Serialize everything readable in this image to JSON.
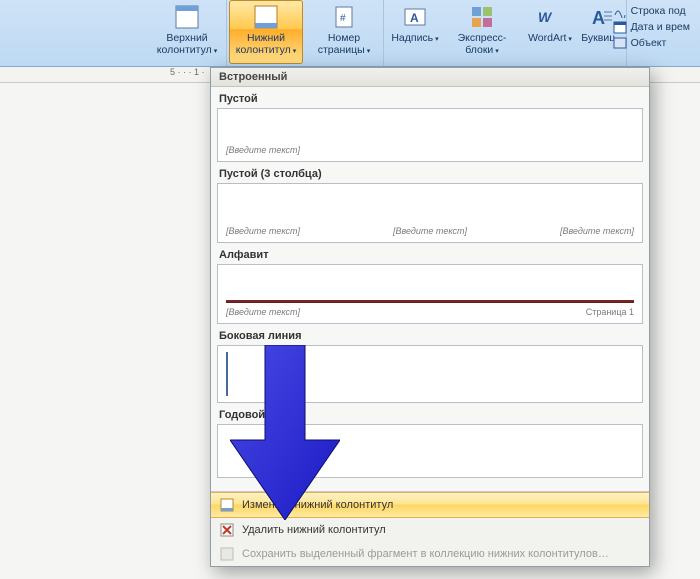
{
  "ribbon": {
    "top_header_btn": "Верхний\nколонтитул",
    "bottom_header_btn": "Нижний\nколонтитул",
    "page_number_btn": "Номер\nстраницы",
    "caption_btn": "Надпись",
    "quickparts_btn": "Экспресс-блоки",
    "wordart_btn": "WordArt",
    "dropcap_btn": "Буквиц",
    "side": {
      "sigline": "Строка под",
      "datetime": "Дата и врем",
      "object": "Объект"
    }
  },
  "ruler": {
    "marks": "5 · · · 1 · "
  },
  "dropdown": {
    "header": "Встроенный",
    "gallery": [
      {
        "label": "Пустой",
        "placeholders": [
          "[Введите текст]"
        ]
      },
      {
        "label": "Пустой (3 столбца)",
        "placeholders": [
          "[Введите текст]",
          "[Введите текст]",
          "[Введите текст]"
        ]
      },
      {
        "label": "Алфавит",
        "placeholders": [
          "[Введите текст]"
        ],
        "page_label": "Страница 1"
      },
      {
        "label": "Боковая линия",
        "placeholders": []
      },
      {
        "label": "Годовой",
        "placeholders": []
      }
    ],
    "menu": {
      "edit": "Изменить нижний колонтитул",
      "remove": "Удалить нижний колонтитул",
      "save": "Сохранить выделенный фрагмент в коллекцию нижних колонтитулов…"
    }
  }
}
